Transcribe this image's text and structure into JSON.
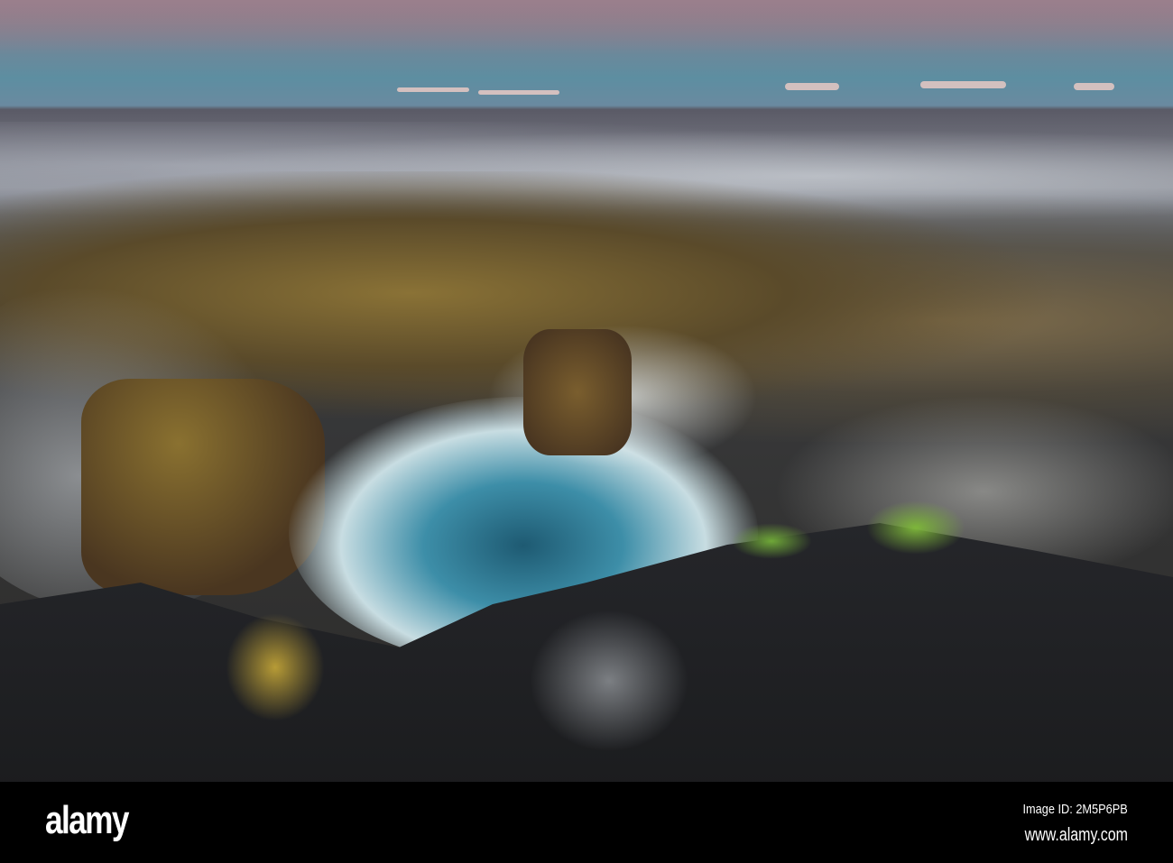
{
  "watermark": {
    "logo": "alamy",
    "image_id": "Image ID: 2M5P6PB",
    "site": "www.alamy.com"
  }
}
